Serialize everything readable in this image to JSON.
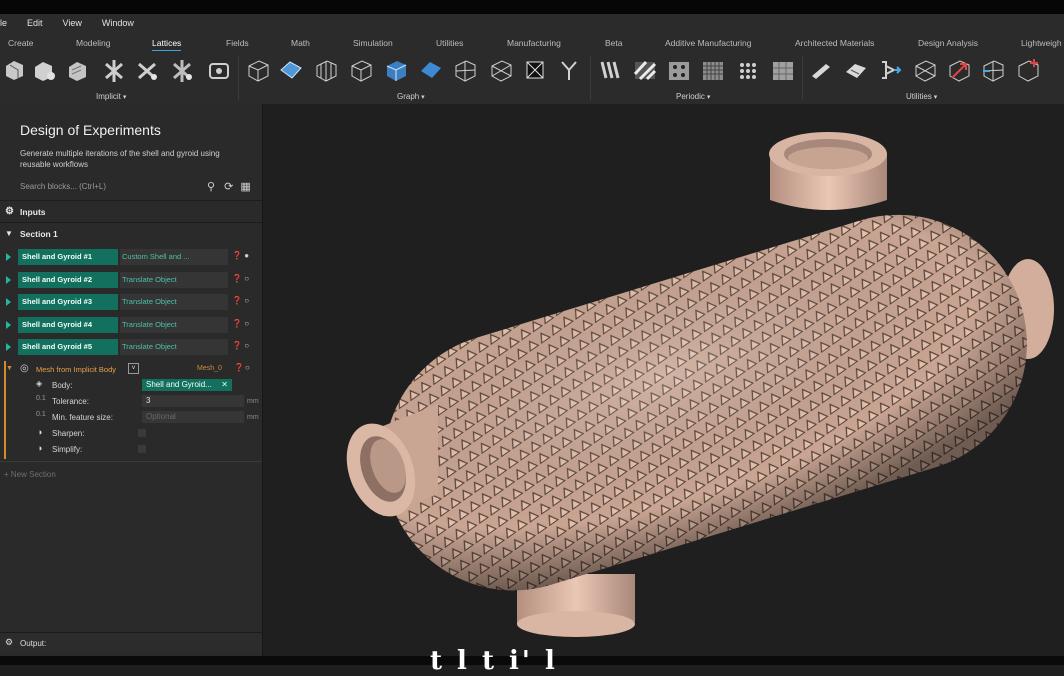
{
  "menu": [
    "ile",
    "Edit",
    "View",
    "Window"
  ],
  "tabs": [
    "Create",
    "Modeling",
    "Lattices",
    "Fields",
    "Math",
    "Simulation",
    "Utilities",
    "Manufacturing",
    "Beta",
    "Additive Manufacturing",
    "Architected Materials",
    "Design Analysis",
    "Lightweigh"
  ],
  "active_tab": "Lattices",
  "toolbar_groups": {
    "implicit": "Implicit",
    "graph": "Graph",
    "periodic": "Periodic",
    "utilities": "Utilities"
  },
  "panel": {
    "title": "Design of Experiments",
    "description": "Generate multiple iterations of the shell and gyroid using reusable workflows",
    "search_placeholder": "Search blocks... (Ctrl+L)",
    "inputs_label": "Inputs",
    "section_label": "Section 1",
    "blocks": [
      {
        "name": "Shell and Gyroid #1",
        "op": "Custom Shell and ..."
      },
      {
        "name": "Shell and Gyroid #2",
        "op": "Translate Object"
      },
      {
        "name": "Shell and Gyroid #3",
        "op": "Translate Object"
      },
      {
        "name": "Shell and Gyroid #4",
        "op": "Translate Object"
      },
      {
        "name": "Shell and Gyroid #5",
        "op": "Translate Object"
      }
    ],
    "mesh": {
      "title": "Mesh from Implicit Body",
      "output_name": "Mesh_0",
      "body_label": "Body:",
      "body_value": "Shell and Gyroid...",
      "tolerance_label": "Tolerance:",
      "tolerance_value": "3",
      "minfeature_label": "Min. feature size:",
      "minfeature_placeholder": "Optional",
      "unit": "mm",
      "sharpen_label": "Sharpen:",
      "simplify_label": "Simplify:"
    },
    "new_section": "+ New Section",
    "output_label": "Output:"
  },
  "subtitle": "t   l       t   i' l"
}
